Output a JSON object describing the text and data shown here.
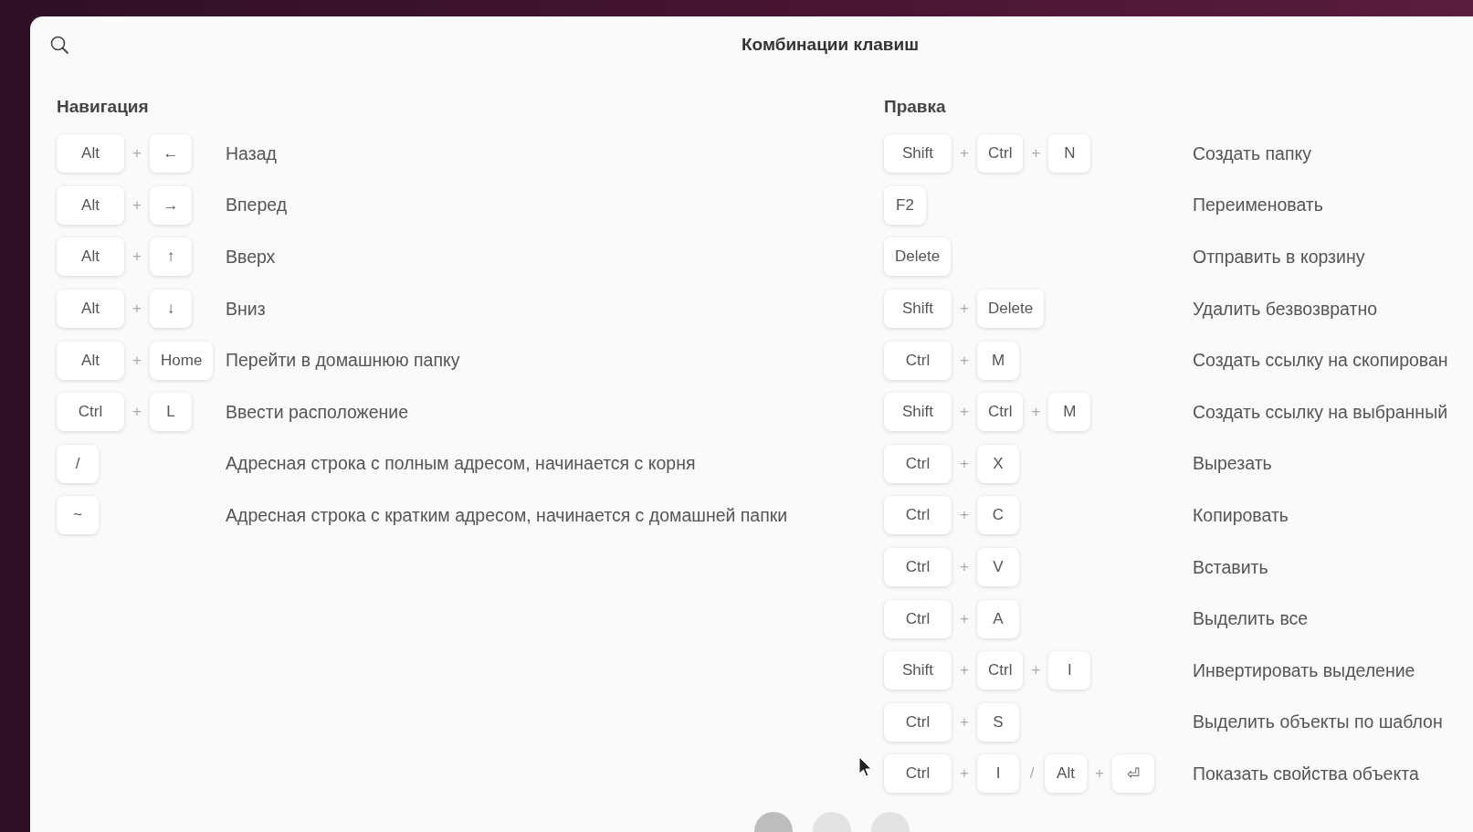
{
  "window": {
    "title": "Комбинации клавиш"
  },
  "sections": [
    {
      "title": "Навигация",
      "shortcuts": [
        {
          "keys": [
            {
              "kind": "key",
              "text": "Alt"
            },
            {
              "kind": "sep",
              "text": "+"
            },
            {
              "kind": "key",
              "text": "←"
            }
          ],
          "description": "Назад"
        },
        {
          "keys": [
            {
              "kind": "key",
              "text": "Alt"
            },
            {
              "kind": "sep",
              "text": "+"
            },
            {
              "kind": "key",
              "text": "→"
            }
          ],
          "description": "Вперед"
        },
        {
          "keys": [
            {
              "kind": "key",
              "text": "Alt"
            },
            {
              "kind": "sep",
              "text": "+"
            },
            {
              "kind": "key",
              "text": "↑"
            }
          ],
          "description": "Вверх"
        },
        {
          "keys": [
            {
              "kind": "key",
              "text": "Alt"
            },
            {
              "kind": "sep",
              "text": "+"
            },
            {
              "kind": "key",
              "text": "↓"
            }
          ],
          "description": "Вниз"
        },
        {
          "keys": [
            {
              "kind": "key",
              "text": "Alt"
            },
            {
              "kind": "sep",
              "text": "+"
            },
            {
              "kind": "key",
              "text": "Home"
            }
          ],
          "description": "Перейти в домашнюю папку"
        },
        {
          "keys": [
            {
              "kind": "key",
              "text": "Ctrl"
            },
            {
              "kind": "sep",
              "text": "+"
            },
            {
              "kind": "key",
              "text": "L"
            }
          ],
          "description": "Ввести расположение"
        },
        {
          "keys": [
            {
              "kind": "key",
              "text": "/"
            }
          ],
          "description": "Адресная строка с полным адресом, начинается с корня"
        },
        {
          "keys": [
            {
              "kind": "key",
              "text": "~"
            }
          ],
          "description": "Адресная строка с кратким адресом, начинается с домашней папки"
        }
      ]
    },
    {
      "title": "Правка",
      "shortcuts": [
        {
          "keys": [
            {
              "kind": "key",
              "text": "Shift"
            },
            {
              "kind": "sep",
              "text": "+"
            },
            {
              "kind": "key",
              "text": "Ctrl"
            },
            {
              "kind": "sep",
              "text": "+"
            },
            {
              "kind": "key",
              "text": "N"
            }
          ],
          "description": "Создать папку"
        },
        {
          "keys": [
            {
              "kind": "key",
              "text": "F2"
            }
          ],
          "description": "Переименовать"
        },
        {
          "keys": [
            {
              "kind": "key",
              "text": "Delete"
            }
          ],
          "description": "Отправить в корзину"
        },
        {
          "keys": [
            {
              "kind": "key",
              "text": "Shift"
            },
            {
              "kind": "sep",
              "text": "+"
            },
            {
              "kind": "key",
              "text": "Delete"
            }
          ],
          "description": "Удалить безвозвратно"
        },
        {
          "keys": [
            {
              "kind": "key",
              "text": "Ctrl"
            },
            {
              "kind": "sep",
              "text": "+"
            },
            {
              "kind": "key",
              "text": "M"
            }
          ],
          "description": "Создать ссылку на скопирован"
        },
        {
          "keys": [
            {
              "kind": "key",
              "text": "Shift"
            },
            {
              "kind": "sep",
              "text": "+"
            },
            {
              "kind": "key",
              "text": "Ctrl"
            },
            {
              "kind": "sep",
              "text": "+"
            },
            {
              "kind": "key",
              "text": "M"
            }
          ],
          "description": "Создать ссылку на выбранный"
        },
        {
          "keys": [
            {
              "kind": "key",
              "text": "Ctrl"
            },
            {
              "kind": "sep",
              "text": "+"
            },
            {
              "kind": "key",
              "text": "X"
            }
          ],
          "description": "Вырезать"
        },
        {
          "keys": [
            {
              "kind": "key",
              "text": "Ctrl"
            },
            {
              "kind": "sep",
              "text": "+"
            },
            {
              "kind": "key",
              "text": "C"
            }
          ],
          "description": "Копировать"
        },
        {
          "keys": [
            {
              "kind": "key",
              "text": "Ctrl"
            },
            {
              "kind": "sep",
              "text": "+"
            },
            {
              "kind": "key",
              "text": "V"
            }
          ],
          "description": "Вставить"
        },
        {
          "keys": [
            {
              "kind": "key",
              "text": "Ctrl"
            },
            {
              "kind": "sep",
              "text": "+"
            },
            {
              "kind": "key",
              "text": "A"
            }
          ],
          "description": "Выделить все"
        },
        {
          "keys": [
            {
              "kind": "key",
              "text": "Shift"
            },
            {
              "kind": "sep",
              "text": "+"
            },
            {
              "kind": "key",
              "text": "Ctrl"
            },
            {
              "kind": "sep",
              "text": "+"
            },
            {
              "kind": "key",
              "text": "I"
            }
          ],
          "description": "Инвертировать выделение"
        },
        {
          "keys": [
            {
              "kind": "key",
              "text": "Ctrl"
            },
            {
              "kind": "sep",
              "text": "+"
            },
            {
              "kind": "key",
              "text": "S"
            }
          ],
          "description": "Выделить объекты по шаблон"
        },
        {
          "keys": [
            {
              "kind": "key",
              "text": "Ctrl"
            },
            {
              "kind": "sep",
              "text": "+"
            },
            {
              "kind": "key",
              "text": "I"
            },
            {
              "kind": "sep",
              "text": "/"
            },
            {
              "kind": "key",
              "text": "Alt"
            },
            {
              "kind": "sep",
              "text": "+"
            },
            {
              "kind": "key",
              "text": "⏎"
            }
          ],
          "description": "Показать свойства объекта"
        }
      ]
    }
  ],
  "pages": [
    {
      "selected": true
    },
    {
      "selected": false
    },
    {
      "selected": false
    }
  ]
}
